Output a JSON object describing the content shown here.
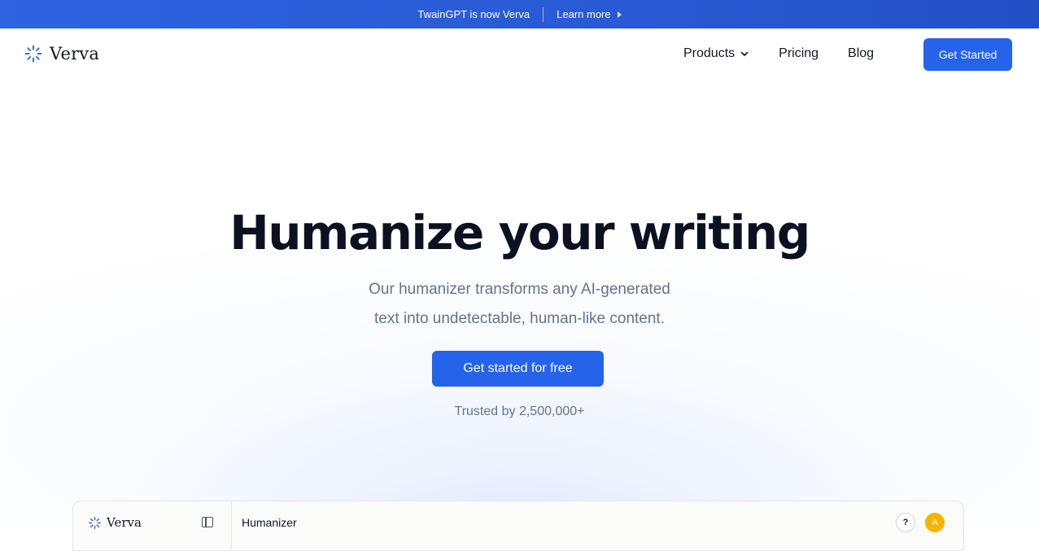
{
  "announcement": {
    "message": "TwainGPT is now Verva",
    "link_label": "Learn more"
  },
  "header": {
    "brand": "Verva",
    "nav": {
      "products": "Products",
      "pricing": "Pricing",
      "blog": "Blog"
    },
    "cta_label": "Get Started"
  },
  "hero": {
    "title": "Humanize your writing",
    "subtitle_line1": "Our humanizer transforms any AI-generated",
    "subtitle_line2": "text into undetectable, human-like content.",
    "cta_label": "Get started for free",
    "trusted_text": "Trusted by 2,500,000+"
  },
  "app_preview": {
    "brand": "Verva",
    "page_title": "Humanizer",
    "help_label": "?",
    "avatar_initial": "A"
  },
  "icons": {
    "brand_logo": "verva-logo-icon",
    "products_chevron": "chevron-down-icon",
    "learn_more_arrow": "play-arrow-icon",
    "sidebar_toggle": "sidebar-toggle-icon"
  },
  "colors": {
    "accent": "#2563eb",
    "banner": "#2a5bd7",
    "avatar": "#f5b400",
    "muted_text": "#64748b"
  }
}
